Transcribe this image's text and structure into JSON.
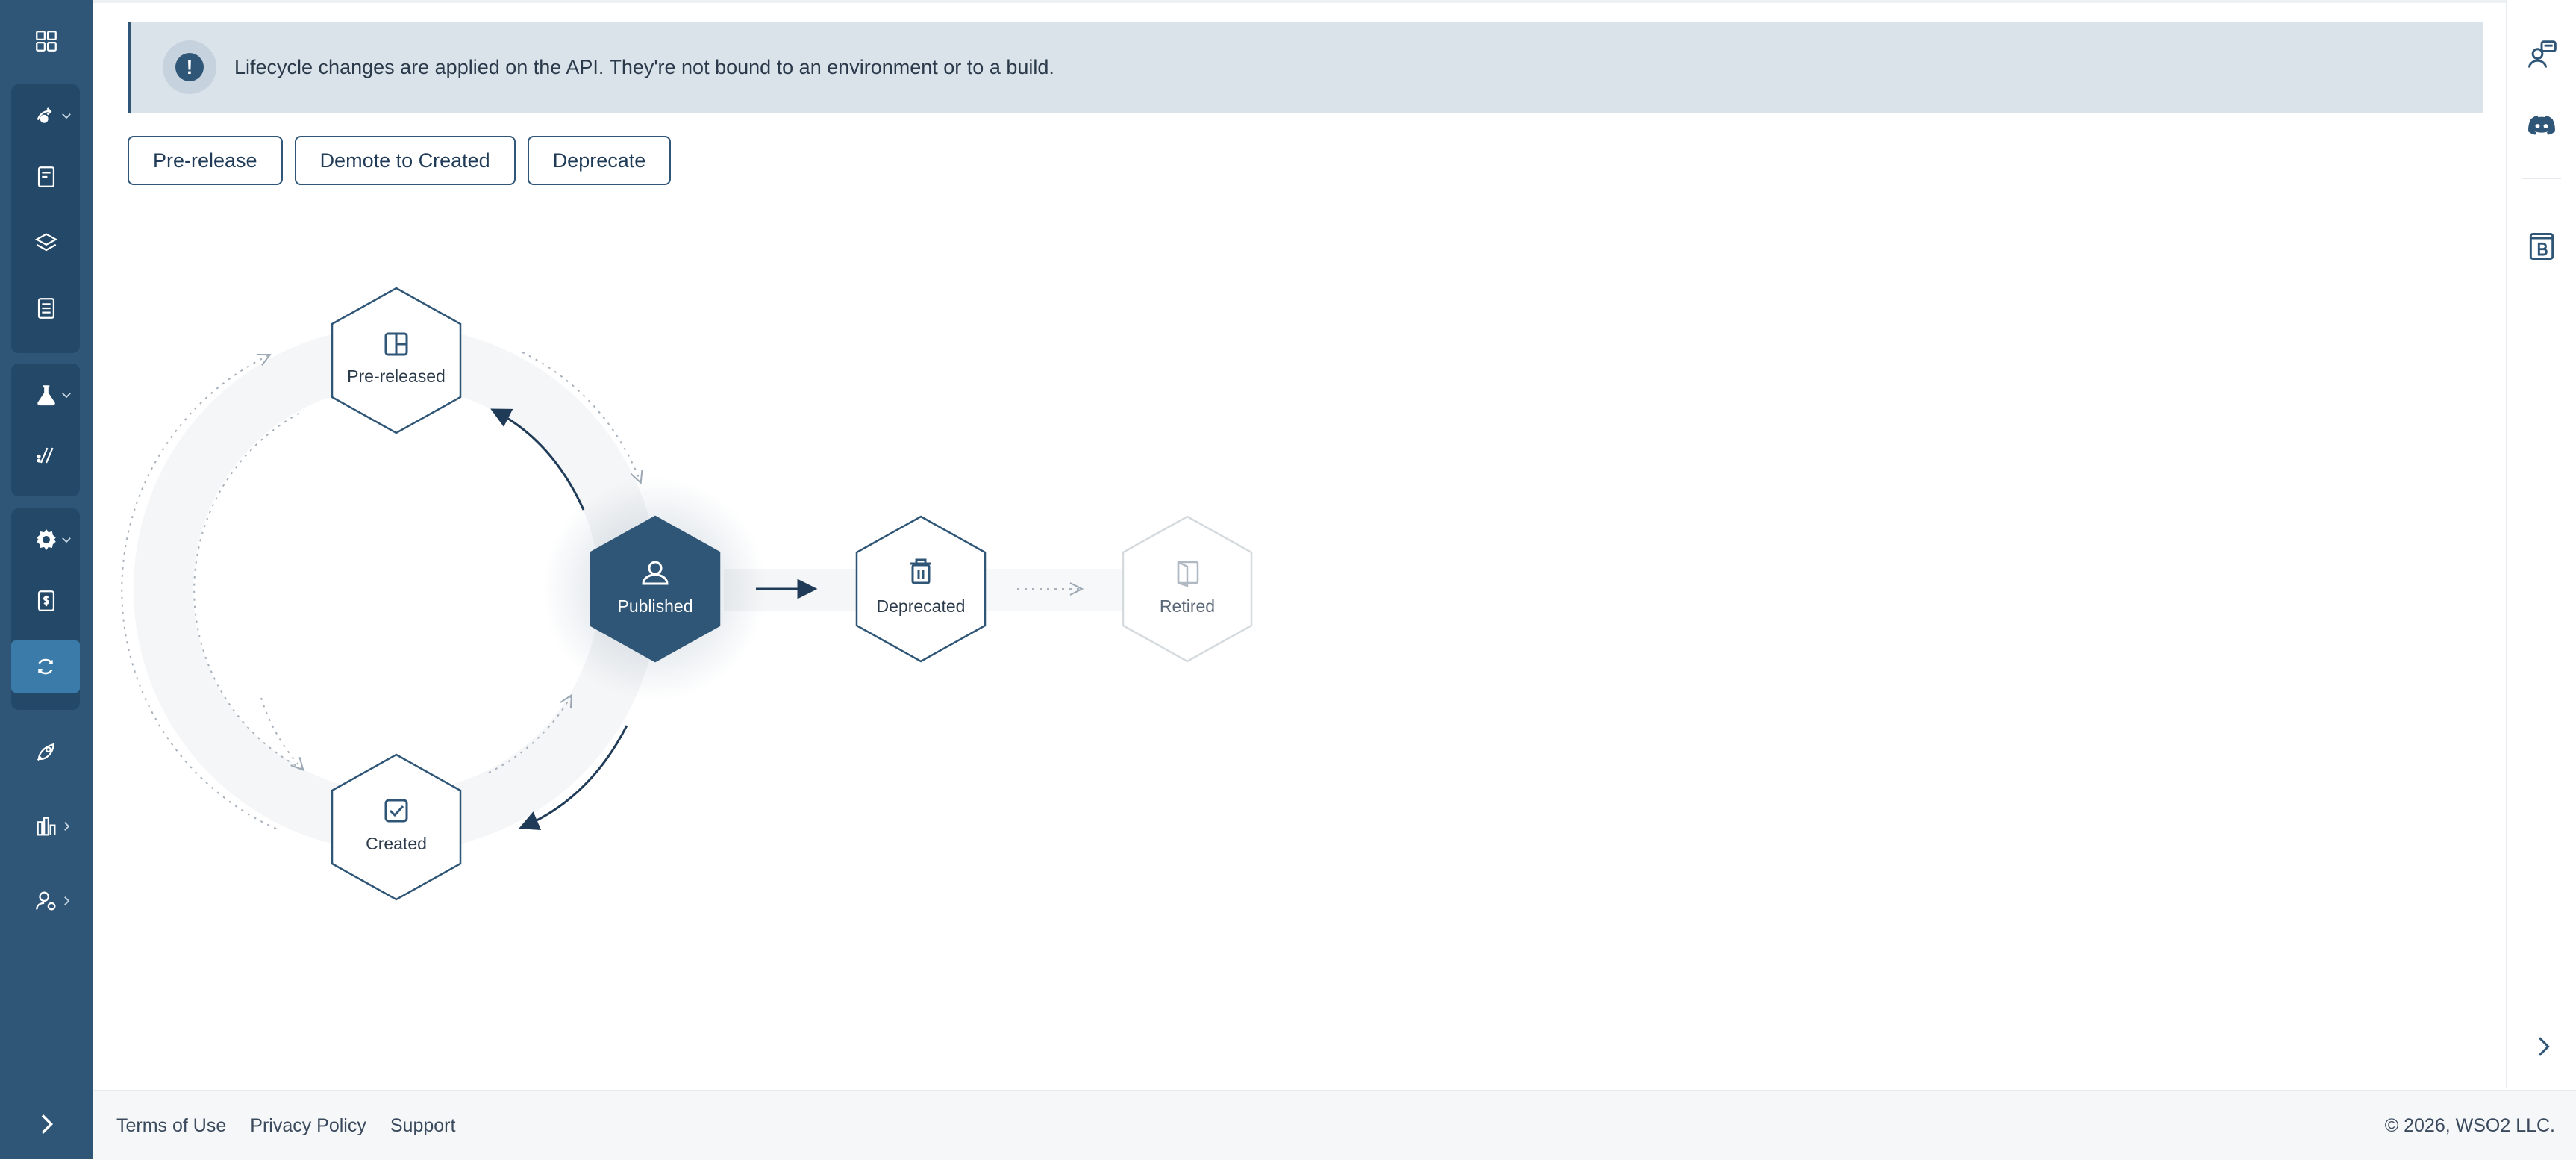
{
  "banner": {
    "icon": "exclamation-icon",
    "message": "Lifecycle changes are applied on the API. They're not bound to an environment or to a build."
  },
  "actions": {
    "pre_release": "Pre-release",
    "demote": "Demote to Created",
    "deprecate": "Deprecate"
  },
  "lifecycle": {
    "current_state": "Published",
    "states": {
      "pre_released": {
        "label": "Pre-released",
        "icon": "layout-icon"
      },
      "published": {
        "label": "Published",
        "icon": "user-icon"
      },
      "deprecated": {
        "label": "Deprecated",
        "icon": "trash-icon"
      },
      "retired": {
        "label": "Retired",
        "icon": "door-icon"
      },
      "created": {
        "label": "Created",
        "icon": "checkbox-icon"
      }
    }
  },
  "sidebar": {
    "items": [
      {
        "name": "overview",
        "icon": "grid-icon"
      },
      {
        "name": "develop",
        "icon": "develop-icon"
      },
      {
        "name": "definition",
        "icon": "document-icon"
      },
      {
        "name": "resources",
        "icon": "layers-icon"
      },
      {
        "name": "docs",
        "icon": "list-document-icon"
      },
      {
        "name": "test",
        "icon": "flask-icon"
      },
      {
        "name": "try-out",
        "icon": "slash-icon"
      },
      {
        "name": "manage",
        "icon": "gear-icon"
      },
      {
        "name": "monetization",
        "icon": "dollar-doc-icon"
      },
      {
        "name": "lifecycle",
        "icon": "cycle-icon"
      },
      {
        "name": "deploy",
        "icon": "rocket-icon"
      },
      {
        "name": "insights",
        "icon": "bar-chart-icon"
      },
      {
        "name": "people",
        "icon": "people-icon"
      }
    ]
  },
  "right_rail": {
    "items": [
      "support-chat-icon",
      "discord-icon",
      "book-icon"
    ]
  },
  "footer": {
    "terms": "Terms of Use",
    "privacy": "Privacy Policy",
    "support": "Support",
    "copyright": "© 2026, WSO2 LLC."
  }
}
